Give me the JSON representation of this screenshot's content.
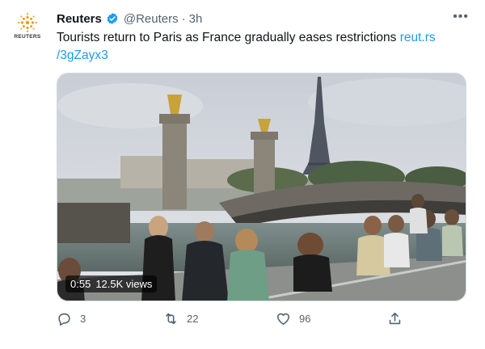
{
  "tweet": {
    "author_name": "Reuters",
    "handle": "@Reuters",
    "separator": "·",
    "time": "3h",
    "avatar_label": "REUTERS",
    "text": "Tourists return to Paris as France gradually eases restrictions ",
    "link_text": "reut.rs\n/3gZayx3"
  },
  "media": {
    "duration": "0:55",
    "views": "12.5K views"
  },
  "actions": {
    "replies": "3",
    "retweets": "22",
    "likes": "96"
  },
  "icons": {
    "more": "more-horizontal-icon",
    "verified": "verified-badge-icon",
    "reply": "reply-icon",
    "retweet": "retweet-icon",
    "like": "heart-icon",
    "share": "share-icon"
  },
  "colors": {
    "link": "#1d9bf0",
    "verified": "#1d9bf0",
    "muted": "#536471"
  }
}
